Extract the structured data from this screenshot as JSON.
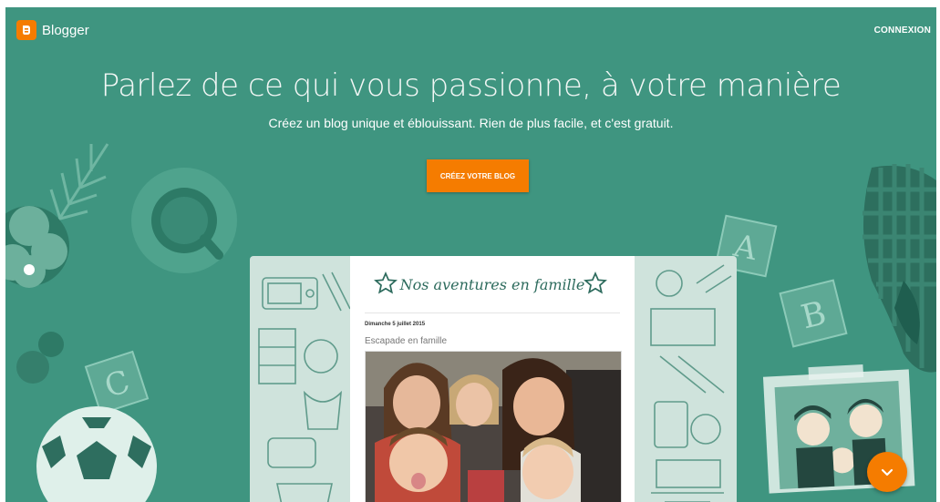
{
  "header": {
    "brand": "Blogger",
    "login_label": "CONNEXION"
  },
  "hero": {
    "title": "Parlez de ce qui vous passionne, à votre manière",
    "subtitle": "Créez un blog unique et éblouissant. Rien de plus facile, et c'est gratuit.",
    "cta_label": "CRÉEZ VOTRE BLOG"
  },
  "mock_blog": {
    "title": "Nos aventures en famille",
    "post_date": "Dimanche 5 juillet 2015",
    "post_title": "Escapade en famille"
  },
  "decorations": {
    "block_a": "A",
    "block_b": "B",
    "block_c": "C"
  },
  "colors": {
    "background": "#3f9580",
    "accent": "#f57c00",
    "card": "#ffffff"
  },
  "icons": {
    "logo": "blogger-logo-icon",
    "scroll": "chevron-down-icon",
    "stars": "star-outline-icon",
    "decorations": [
      "leaf-icon",
      "flower-icon",
      "coffee-cup-icon",
      "soccer-ball-icon",
      "letter-block-icon",
      "oven-mitt-icon",
      "family-frame-icon"
    ]
  }
}
